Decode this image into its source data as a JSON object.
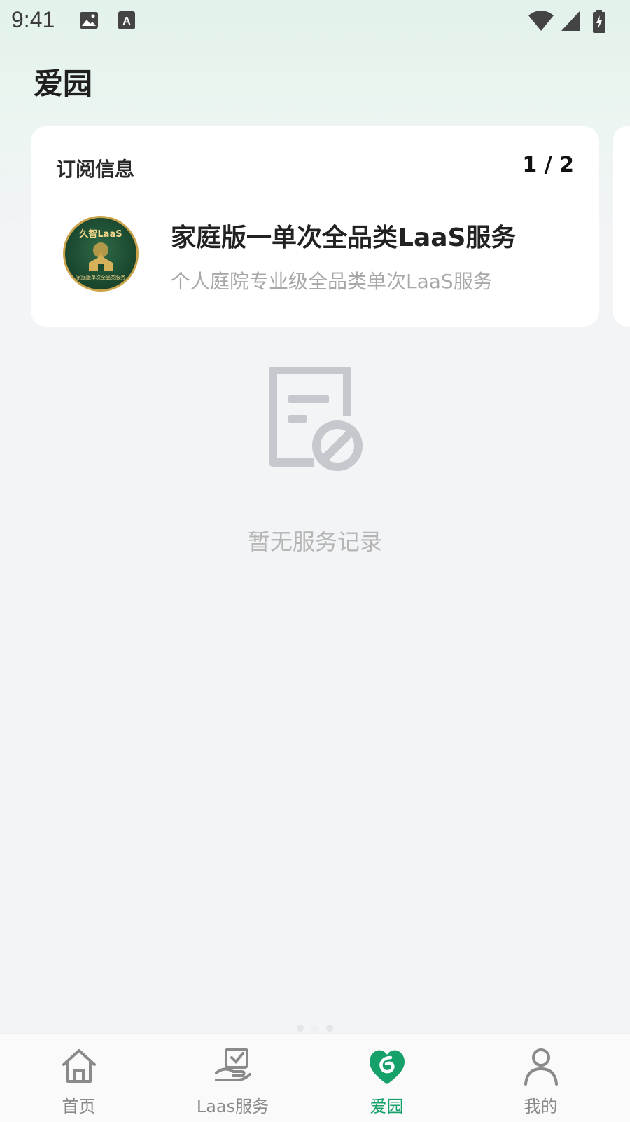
{
  "status_bar": {
    "time": "9:41",
    "icons": [
      "image-icon",
      "a-icon",
      "wifi-icon",
      "signal-icon",
      "battery-icon"
    ]
  },
  "page": {
    "title": "爱园"
  },
  "subscription_card": {
    "label": "订阅信息",
    "pager": "1 / 2",
    "badge": {
      "top_text": "久智LaaS",
      "bottom_text": "家庭版单次全品类服务"
    },
    "plan_title": "家庭版一单次全品类LaaS服务",
    "plan_desc": "个人庭院专业级全品类单次LaaS服务"
  },
  "empty_state": {
    "icon": "no-records-icon",
    "message": "暂无服务记录"
  },
  "tab_bar": {
    "tabs": [
      {
        "label": "首页",
        "icon": "home-icon",
        "active": false
      },
      {
        "label": "Laas服务",
        "icon": "hand-service-icon",
        "active": false
      },
      {
        "label": "爱园",
        "icon": "heart-garden-icon",
        "active": true
      },
      {
        "label": "我的",
        "icon": "user-icon",
        "active": false
      }
    ]
  },
  "colors": {
    "accent": "#16a06a",
    "inactive": "#8a8a8a",
    "background": "#f2f4f6"
  }
}
